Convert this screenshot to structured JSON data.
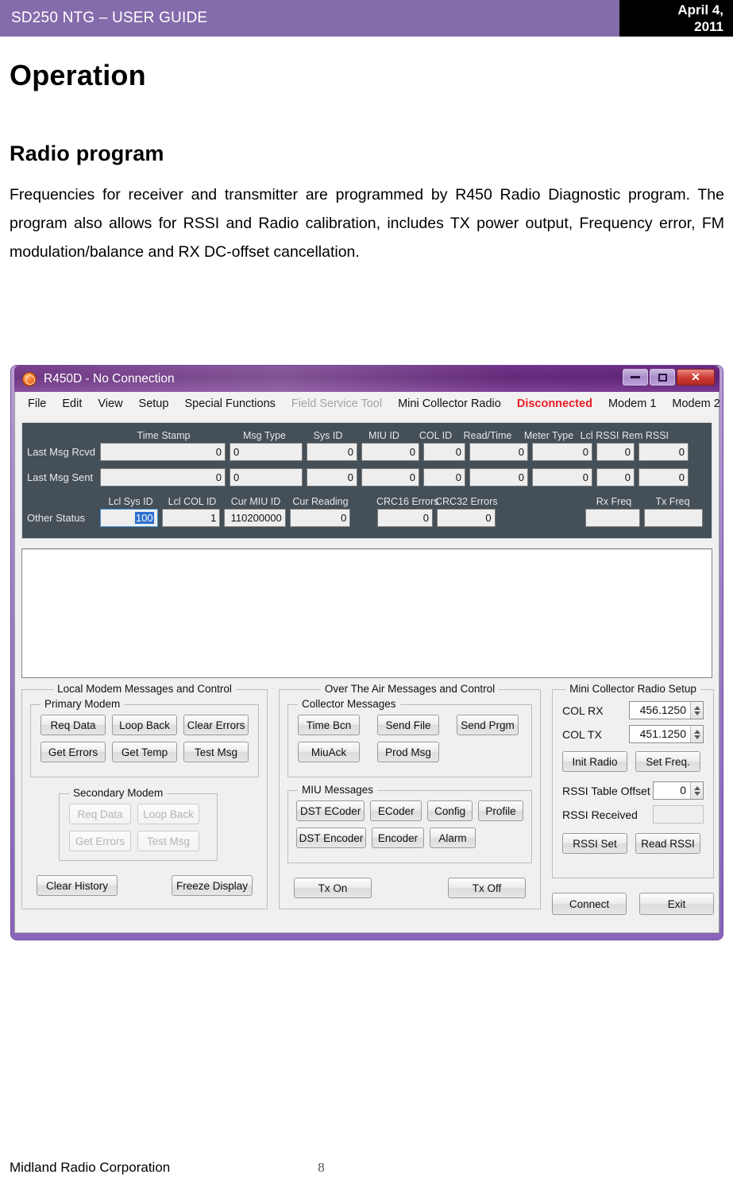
{
  "doc": {
    "header_title": "SD250 NTG – USER GUIDE",
    "header_date_line1": "April 4,",
    "header_date_line2": "2011",
    "heading1": "Operation",
    "heading2": "Radio program",
    "paragraph": "Frequencies for receiver and transmitter are programmed by R450 Radio Diagnostic program. The program also allows for RSSI and Radio calibration, includes TX power output, Frequency error, FM modulation/balance and RX DC-offset cancellation.",
    "footer_company": "Midland Radio Corporation",
    "footer_page": "8",
    "accent_color": "#846bab"
  },
  "app": {
    "title": "R450D - No Connection",
    "icon": "radio-logo-icon",
    "window_buttons": {
      "minimize": "minimize-icon",
      "maximize": "maximize-icon",
      "close": "✕"
    },
    "menu": [
      {
        "label": "File",
        "state": "enabled"
      },
      {
        "label": "Edit",
        "state": "enabled"
      },
      {
        "label": "View",
        "state": "enabled"
      },
      {
        "label": "Setup",
        "state": "enabled"
      },
      {
        "label": "Special Functions",
        "state": "enabled"
      },
      {
        "label": "Field Service Tool",
        "state": "disabled"
      },
      {
        "label": "Mini Collector Radio",
        "state": "enabled"
      },
      {
        "label": "Disconnected",
        "state": "alert"
      },
      {
        "label": "Modem 1",
        "state": "enabled"
      },
      {
        "label": "Modem 2",
        "state": "enabled"
      }
    ],
    "status_panel": {
      "columns": [
        "Time Stamp",
        "Msg Type",
        "Sys ID",
        "MIU ID",
        "COL ID",
        "Read/Time",
        "Meter Type",
        "Lcl RSSI",
        "Rem RSSI"
      ],
      "rows": [
        {
          "label": "Last Msg Rcvd",
          "values": [
            "0",
            "0",
            "0",
            "0",
            "0",
            "0",
            "0",
            "0",
            "0"
          ]
        },
        {
          "label": "Last Msg Sent",
          "values": [
            "0",
            "0",
            "0",
            "0",
            "0",
            "0",
            "0",
            "0",
            "0"
          ]
        }
      ],
      "other_status": {
        "label": "Other Status",
        "columns": [
          "Lcl Sys ID",
          "Lcl COL ID",
          "Cur MIU ID",
          "Cur Reading",
          "CRC16 Errors",
          "CRC32 Errors",
          "Rx Freq",
          "Tx Freq"
        ],
        "values": [
          "100",
          "1",
          "110200000",
          "0",
          "0",
          "0",
          "",
          ""
        ],
        "selected_index": 0,
        "selection_color": "#2d6fd0"
      },
      "panel_color": "#454f57"
    },
    "log_area": {
      "content": ""
    },
    "local_modem": {
      "legend": "Local Modem Messages and Control",
      "primary": {
        "legend": "Primary Modem",
        "buttons": [
          "Req Data",
          "Loop Back",
          "Clear Errors",
          "Get Errors",
          "Get Temp",
          "Test Msg"
        ]
      },
      "secondary": {
        "legend": "Secondary Modem",
        "buttons": [
          "Req Data",
          "Loop Back",
          "Get Errors",
          "Test Msg"
        ],
        "disabled": true
      },
      "bottom_buttons": [
        "Clear History",
        "Freeze Display"
      ]
    },
    "over_the_air": {
      "legend": "Over The Air Messages and Control",
      "collector": {
        "legend": "Collector Messages",
        "buttons": [
          "Time Bcn",
          "Send File",
          "Send Prgm",
          "MiuAck",
          "Prod Msg"
        ]
      },
      "miu": {
        "legend": "MIU Messages",
        "buttons": [
          "DST ECoder",
          "ECoder",
          "Config",
          "Profile",
          "DST Encoder",
          "Encoder",
          "Alarm"
        ]
      },
      "bottom_buttons": [
        "Tx On",
        "Tx Off"
      ]
    },
    "mini_collector": {
      "legend": "Mini Collector Radio Setup",
      "col_rx_label": "COL RX",
      "col_rx_value": "456.1250",
      "col_tx_label": "COL TX",
      "col_tx_value": "451.1250",
      "init_radio": "Init Radio",
      "set_freq": "Set Freq.",
      "rssi_offset_label": "RSSI Table Offset",
      "rssi_offset_value": "0",
      "rssi_received_label": "RSSI Received",
      "rssi_received_value": "",
      "rssi_set": "RSSI Set",
      "read_rssi": "Read RSSI",
      "connect": "Connect",
      "exit": "Exit"
    }
  }
}
